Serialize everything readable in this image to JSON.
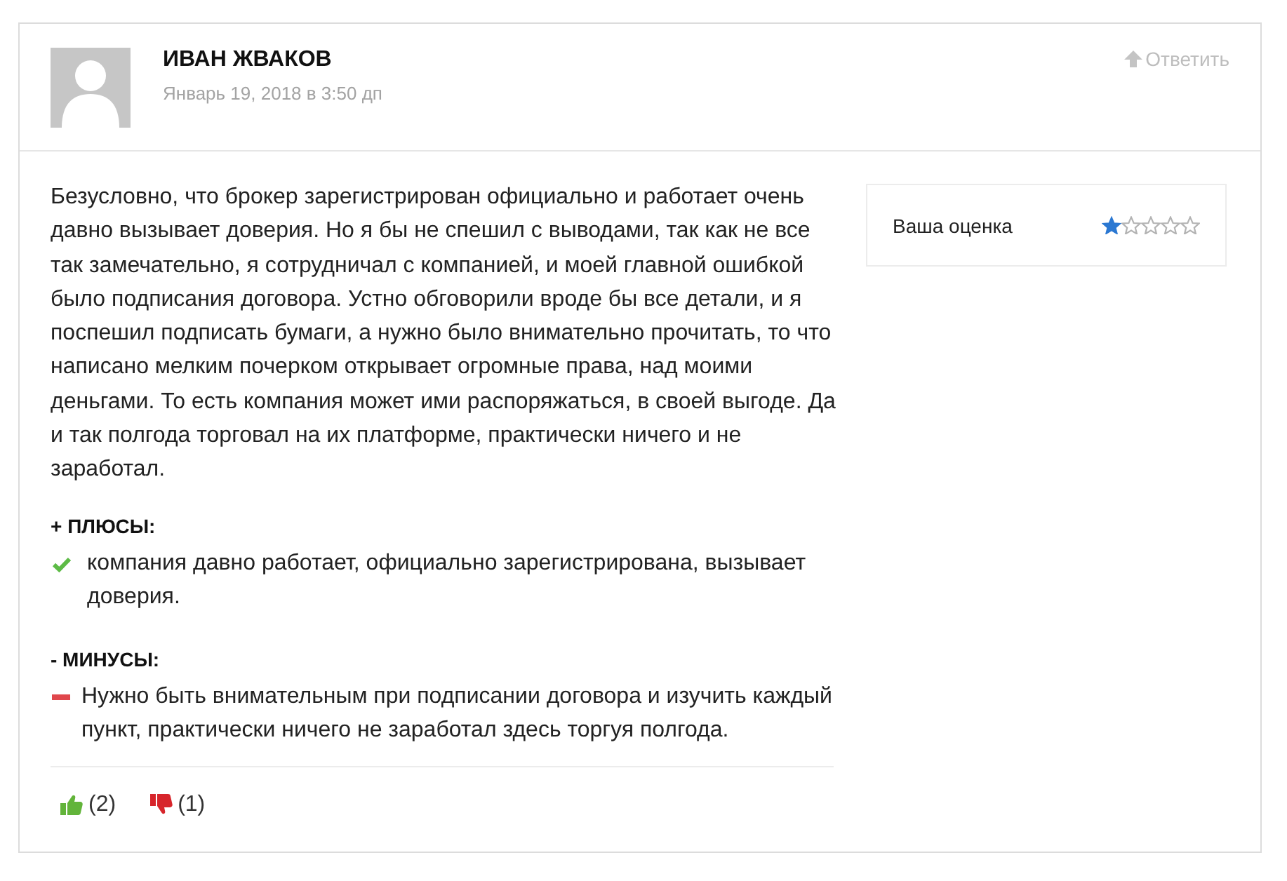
{
  "comment": {
    "author": "ИВАН ЖВАКОВ",
    "date": "Январь 19, 2018 в 3:50 дп",
    "reply": "Ответить",
    "text": "Безусловно, что брокер зарегистрирован официально и работает очень давно вызывает доверия. Но я бы не спешил с выводами, так как не все так замечательно, я сотрудничал с компанией, и моей главной ошибкой было подписания договора. Устно обговорили вроде бы все детали, и я поспешил подписать бумаги, а нужно было внимательно прочитать, то что написано мелким почерком открывает огромные права, над моими деньгами. То есть компания может ими распоряжаться, в своей выгоде. Да и так полгода торговал на их платформе, практически ничего и не заработал.",
    "rating": {
      "label": "Ваша оценка",
      "stars": 1
    },
    "sections": [
      {
        "kind": "pros",
        "heading": "+ ПЛЮСЫ:",
        "items": [
          "компания давно работает, официально зарегистрирована, вызывает доверия."
        ]
      },
      {
        "kind": "cons",
        "heading": "- МИНУСЫ:",
        "items": [
          "Нужно быть внимательным при подписании договора и изучить каждый пункт, практически ничего не заработал здесь торгуя полгода."
        ]
      }
    ],
    "votes": [
      {
        "kind": "like",
        "count": "(2)"
      },
      {
        "kind": "dislike",
        "count": "(1)"
      }
    ]
  }
}
